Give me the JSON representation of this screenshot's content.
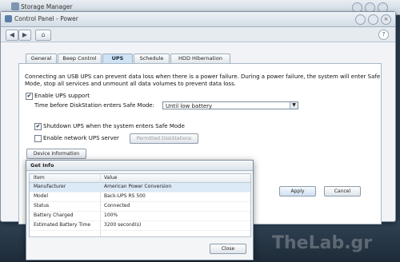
{
  "background_window": {
    "title": "Storage Manager"
  },
  "window": {
    "title": "Control Panel - Power"
  },
  "help_label": "?",
  "close_glyph": "×",
  "tabs": [
    "General",
    "Beep Control",
    "UPS",
    "Schedule",
    "HDD Hibernation"
  ],
  "active_tab": "UPS",
  "ups": {
    "description": "Connecting an USB UPS can prevent data loss when there is a power failure. During a power failure, the system will enter Safe Mode, stop all services and unmount all data volumes to prevent data loss.",
    "enable_label": "Enable UPS support",
    "enable_checked": true,
    "safe_mode_label": "Time before DiskStation enters Safe Mode:",
    "safe_mode_value": "Until low battery",
    "shutdown_label": "Shutdown UPS when the system enters Safe Mode",
    "shutdown_checked": true,
    "network_label": "Enable network UPS server",
    "network_checked": false,
    "permitted_button": "Permitted DiskStations",
    "device_info_button": "Device Information"
  },
  "buttons": {
    "apply": "Apply",
    "cancel": "Cancel"
  },
  "dialog": {
    "title": "Get Info",
    "columns": [
      "Item",
      "Value"
    ],
    "rows": [
      [
        "Manufacturer",
        "American Power Conversion"
      ],
      [
        "Model",
        "Back-UPS RS 500"
      ],
      [
        "Status",
        "Connected"
      ],
      [
        "Battery Charged",
        "100%"
      ],
      [
        "Estimated Battery Time",
        "3200 second(s)"
      ]
    ],
    "close_button": "Close"
  },
  "watermark": "TheLab.gr",
  "icons": {
    "back": "back-arrow-icon",
    "forward": "forward-arrow-icon",
    "home": "home-icon",
    "check": "✔"
  }
}
